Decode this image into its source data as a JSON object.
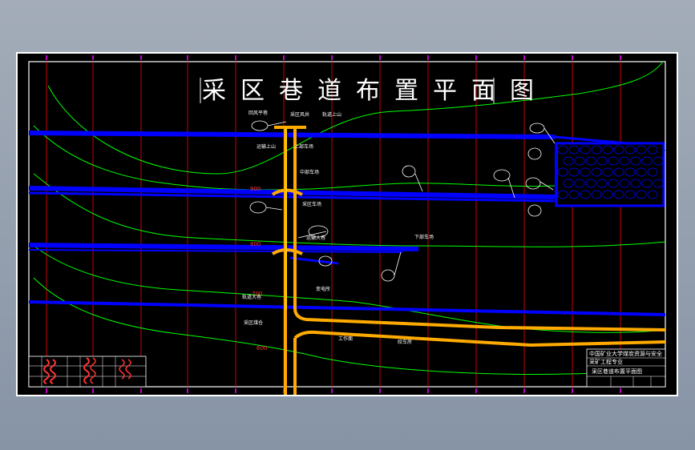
{
  "drawing": {
    "title_chars": [
      "采",
      "区",
      "巷",
      "道",
      "布",
      "置",
      "平",
      "面",
      "图"
    ],
    "elevation_labels": [
      "900",
      "800",
      "700",
      "600"
    ],
    "title_block": {
      "line1": "中国矿业大学煤炭资源与安全",
      "line2": "采矿工程专业",
      "line3": "采区巷道布置平面图"
    },
    "annotations": [
      "回风平巷",
      "采区风井",
      "轨道上山",
      "运输上山",
      "上部车场",
      "中部车场",
      "采区车场",
      "运输大巷",
      "轨道大巷",
      "采区煤仓",
      "工作面",
      "绞车房",
      "变电所",
      "下部车场"
    ]
  },
  "colors": {
    "background": "#000000",
    "roadway": "#0000ff",
    "main_roadway": "#ffaa00",
    "contour": "#00ff00",
    "grid": "#ff0000",
    "border": "#ffffff",
    "marks": "#ff00ff"
  }
}
